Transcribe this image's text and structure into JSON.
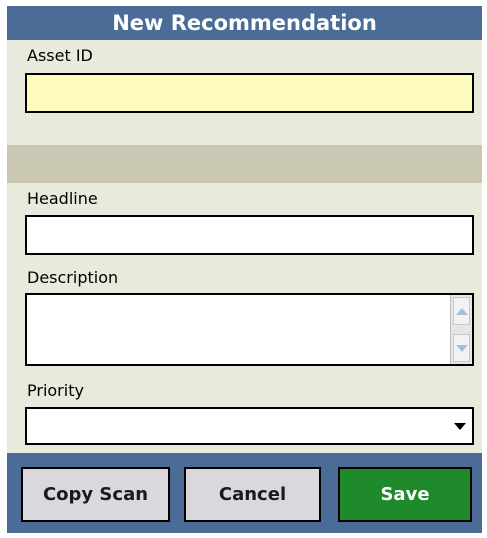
{
  "title": "New Recommendation",
  "fields": {
    "asset_id": {
      "label": "Asset ID",
      "value": ""
    },
    "headline": {
      "label": "Headline",
      "value": ""
    },
    "description": {
      "label": "Description",
      "value": ""
    },
    "priority": {
      "label": "Priority",
      "value": ""
    }
  },
  "buttons": {
    "copy_scan": "Copy Scan",
    "cancel": "Cancel",
    "save": "Save"
  },
  "colors": {
    "header": "#4a6c96",
    "form_background": "#e8eadc",
    "asset_field": "#fffbbf",
    "separator": "#c9c6b1",
    "save_button": "#1e8a2c",
    "secondary_button": "#d9d9dd"
  },
  "icons": {
    "scroll_up": "chevron-up-icon",
    "scroll_down": "chevron-down-icon",
    "dropdown": "caret-down-icon"
  }
}
